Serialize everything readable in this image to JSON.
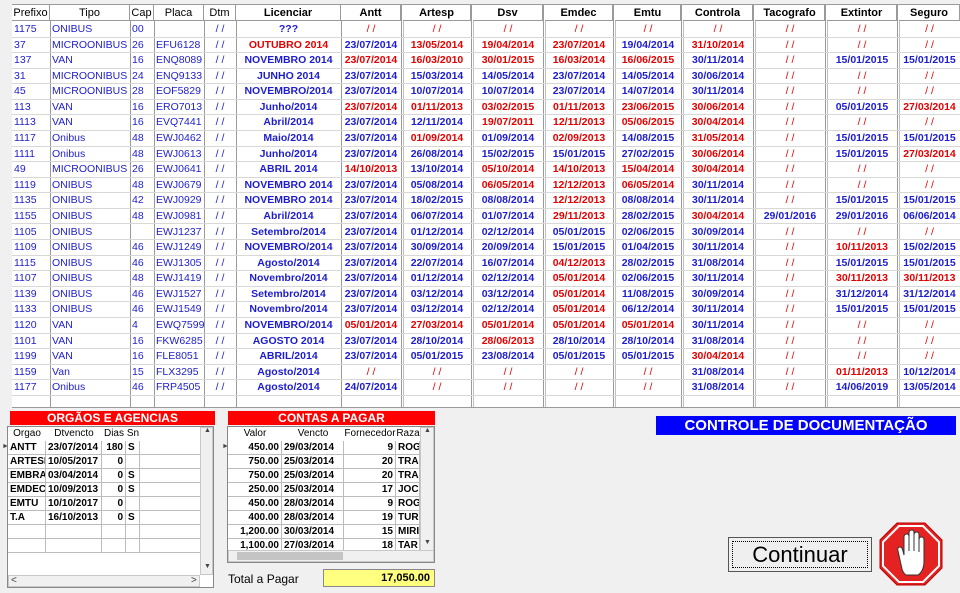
{
  "columns": [
    "Prefixo",
    "Tipo",
    "Cap",
    "Placa",
    "Dtm",
    "Licenciar",
    "Antt",
    "Artesp",
    "Dsv",
    "Emdec",
    "Emtu",
    "Controla",
    "Tacografo",
    "Extintor",
    "Seguro"
  ],
  "rows": [
    [
      "1175",
      "ONIBUS",
      "00",
      "",
      "/ /",
      "???",
      "/ /",
      "/ /",
      "/ /",
      "/ /",
      "/ /",
      "/ /",
      "/ /",
      "/ /",
      "/ /"
    ],
    [
      "37",
      "MICROONIBUS",
      "26",
      "EFU6128",
      "/ /",
      "OUTUBRO 2014",
      "23/07/2014",
      "13/05/2014",
      "19/04/2014",
      "23/07/2014",
      "19/04/2014",
      "31/10/2014",
      "/ /",
      "/ /",
      "/ /"
    ],
    [
      "137",
      "VAN",
      "16",
      "ENQ8089",
      "/ /",
      "NOVEMBRO 2014",
      "23/07/2014",
      "16/03/2010",
      "30/01/2015",
      "16/03/2014",
      "16/06/2015",
      "30/11/2014",
      "/ /",
      "15/01/2015",
      "15/01/2015"
    ],
    [
      "31",
      "MICROONIBUS",
      "24",
      "ENQ9133",
      "/ /",
      "JUNHO 2014",
      "23/07/2014",
      "15/03/2014",
      "14/05/2014",
      "23/07/2014",
      "14/05/2014",
      "30/06/2014",
      "/ /",
      "/ /",
      "/ /"
    ],
    [
      "45",
      "MICROONIBUS",
      "28",
      "EOF5829",
      "/ /",
      "NOVEMBRO/2014",
      "23/07/2014",
      "10/07/2014",
      "10/07/2014",
      "23/07/2014",
      "14/07/2014",
      "30/11/2014",
      "/ /",
      "/ /",
      "/ /"
    ],
    [
      "113",
      "VAN",
      "16",
      "ERO7013",
      "/ /",
      "Junho/2014",
      "23/07/2014",
      "01/11/2013",
      "03/02/2015",
      "01/11/2013",
      "23/06/2015",
      "30/06/2014",
      "/ /",
      "05/01/2015",
      "27/03/2014"
    ],
    [
      "1113",
      "VAN",
      "16",
      "EVQ7441",
      "/ /",
      "Abril/2014",
      "23/07/2014",
      "12/11/2014",
      "19/07/2011",
      "12/11/2013",
      "05/06/2015",
      "30/04/2014",
      "/ /",
      "/ /",
      "/ /"
    ],
    [
      "1117",
      "Onibus",
      "48",
      "EWJ0462",
      "/ /",
      "Maio/2014",
      "23/07/2014",
      "01/09/2014",
      "01/09/2014",
      "02/09/2013",
      "14/08/2015",
      "31/05/2014",
      "/ /",
      "15/01/2015",
      "15/01/2015"
    ],
    [
      "1111",
      "Onibus",
      "48",
      "EWJ0613",
      "/ /",
      "Junho/2014",
      "23/07/2014",
      "26/08/2014",
      "15/02/2015",
      "15/01/2015",
      "27/02/2015",
      "30/06/2014",
      "/ /",
      "15/01/2015",
      "27/03/2014"
    ],
    [
      "49",
      "MICROONIBUS",
      "26",
      "EWJ0641",
      "/ /",
      "ABRIL 2014",
      "14/10/2013",
      "13/10/2014",
      "05/10/2014",
      "14/10/2013",
      "15/04/2014",
      "30/04/2014",
      "/ /",
      "/ /",
      "/ /"
    ],
    [
      "1119",
      "ONIBUS",
      "48",
      "EWJ0679",
      "/ /",
      "NOVEMBRO 2014",
      "23/07/2014",
      "05/08/2014",
      "06/05/2014",
      "12/12/2013",
      "06/05/2014",
      "30/11/2014",
      "/ /",
      "/ /",
      "/ /"
    ],
    [
      "1135",
      "ONIBUS",
      "42",
      "EWJ0929",
      "/ /",
      "NOVEMBRO 2014",
      "23/07/2014",
      "18/02/2015",
      "08/08/2014",
      "12/12/2013",
      "08/08/2014",
      "30/11/2014",
      "/ /",
      "15/01/2015",
      "15/01/2015"
    ],
    [
      "1155",
      "ONIBUS",
      "48",
      "EWJ0981",
      "/ /",
      "Abril/2014",
      "23/07/2014",
      "06/07/2014",
      "01/07/2014",
      "29/11/2013",
      "28/02/2015",
      "30/04/2014",
      "29/01/2016",
      "29/01/2016",
      "06/06/2014"
    ],
    [
      "1105",
      "ONIBUS",
      "",
      "EWJ1237",
      "/ /",
      "Setembro/2014",
      "23/07/2014",
      "01/12/2014",
      "02/12/2014",
      "05/01/2015",
      "02/06/2015",
      "30/09/2014",
      "/ /",
      "/ /",
      "/ /"
    ],
    [
      "1109",
      "ONIBUS",
      "46",
      "EWJ1249",
      "/ /",
      "NOVEMBRO/2014",
      "23/07/2014",
      "30/09/2014",
      "20/09/2014",
      "15/01/2015",
      "01/04/2015",
      "30/11/2014",
      "/ /",
      "10/11/2013",
      "15/02/2015"
    ],
    [
      "1115",
      "ONIBUS",
      "46",
      "EWJ1305",
      "/ /",
      "Agosto/2014",
      "23/07/2014",
      "22/07/2014",
      "16/07/2014",
      "04/12/2013",
      "28/02/2015",
      "31/08/2014",
      "/ /",
      "15/01/2015",
      "15/01/2015"
    ],
    [
      "1107",
      "ONIBUS",
      "48",
      "EWJ1419",
      "/ /",
      "Novembro/2014",
      "23/07/2014",
      "01/12/2014",
      "02/12/2014",
      "05/01/2014",
      "02/06/2015",
      "30/11/2014",
      "/ /",
      "30/11/2013",
      "30/11/2013"
    ],
    [
      "1139",
      "ONIBUS",
      "46",
      "EWJ1527",
      "/ /",
      "Setembro/2014",
      "23/07/2014",
      "03/12/2014",
      "03/12/2014",
      "05/01/2014",
      "11/08/2015",
      "30/09/2014",
      "/ /",
      "31/12/2014",
      "31/12/2014"
    ],
    [
      "1133",
      "ONIBUS",
      "46",
      "EWJ1549",
      "/ /",
      "Novembro/2014",
      "23/07/2014",
      "03/12/2014",
      "02/12/2014",
      "05/01/2014",
      "06/12/2014",
      "30/11/2014",
      "/ /",
      "15/01/2015",
      "15/01/2015"
    ],
    [
      "1120",
      "VAN",
      "4",
      "EWQ7599",
      "/ /",
      "NOVEMBRO/2014",
      "05/01/2014",
      "27/03/2014",
      "05/01/2014",
      "05/01/2014",
      "05/01/2014",
      "30/11/2014",
      "/ /",
      "/ /",
      "/ /"
    ],
    [
      "1101",
      "VAN",
      "16",
      "FKW6285",
      "/ /",
      "AGOSTO 2014",
      "23/07/2014",
      "28/10/2014",
      "28/06/2013",
      "28/10/2014",
      "28/10/2014",
      "31/08/2014",
      "/ /",
      "/ /",
      "/ /"
    ],
    [
      "1199",
      "VAN",
      "16",
      "FLE8051",
      "/ /",
      "ABRIL/2014",
      "23/07/2014",
      "05/01/2015",
      "23/08/2014",
      "05/01/2015",
      "05/01/2015",
      "30/04/2014",
      "/ /",
      "/ /",
      "/ /"
    ],
    [
      "1159",
      "Van",
      "15",
      "FLX3295",
      "/ /",
      "Agosto/2014",
      "/ /",
      "/ /",
      "/ /",
      "/ /",
      "/ /",
      "31/08/2014",
      "/ /",
      "01/11/2013",
      "10/12/2014"
    ],
    [
      "1177",
      "Onibus",
      "46",
      "FRP4505",
      "/ /",
      "Agosto/2014",
      "24/07/2014",
      "/ /",
      "/ /",
      "/ /",
      "/ /",
      "31/08/2014",
      "/ /",
      "14/06/2019",
      "13/05/2014"
    ]
  ],
  "red_cells": [
    [
      5,
      1
    ],
    [
      7,
      1
    ],
    [
      8,
      1
    ],
    [
      9,
      1
    ],
    [
      11,
      1
    ],
    [
      6,
      2
    ],
    [
      7,
      2
    ],
    [
      8,
      2
    ],
    [
      9,
      2
    ],
    [
      10,
      2
    ],
    [
      9,
      5
    ],
    [
      6,
      5
    ],
    [
      7,
      5
    ],
    [
      8,
      5
    ],
    [
      9,
      5
    ],
    [
      10,
      5
    ],
    [
      11,
      5
    ],
    [
      8,
      6
    ],
    [
      9,
      6
    ],
    [
      10,
      6
    ],
    [
      11,
      6
    ],
    [
      7,
      7
    ],
    [
      9,
      7
    ],
    [
      11,
      7
    ],
    [
      14,
      8
    ],
    [
      11,
      8
    ],
    [
      6,
      9
    ],
    [
      8,
      9
    ],
    [
      9,
      9
    ],
    [
      10,
      9
    ],
    [
      11,
      9
    ],
    [
      8,
      10
    ],
    [
      9,
      10
    ],
    [
      10,
      10
    ],
    [
      9,
      11
    ],
    [
      9,
      12
    ],
    [
      11,
      12
    ],
    [
      13,
      14
    ],
    [
      9,
      15
    ],
    [
      9,
      16
    ],
    [
      13,
      16
    ],
    [
      14,
      16
    ],
    [
      9,
      17
    ],
    [
      9,
      18
    ],
    [
      6,
      19
    ],
    [
      7,
      19
    ],
    [
      8,
      19
    ],
    [
      9,
      19
    ],
    [
      10,
      19
    ],
    [
      8,
      20
    ],
    [
      11,
      21
    ],
    [
      13,
      22
    ],
    [
      14,
      5
    ]
  ],
  "orgaos": {
    "title": "ORGÃOS E AGENCIAS",
    "headers": [
      "Orgao",
      "Dtvencto",
      "Dias",
      "Sn"
    ],
    "rows": [
      [
        "ANTT",
        "23/07/2014",
        "180",
        "S"
      ],
      [
        "ARTESP",
        "10/05/2017",
        "0",
        ""
      ],
      [
        "EMBRATUR",
        "03/04/2014",
        "0",
        "S"
      ],
      [
        "EMDEC",
        "10/09/2013",
        "0",
        "S"
      ],
      [
        "EMTU",
        "10/10/2017",
        "0",
        ""
      ],
      [
        "T.A",
        "16/10/2013",
        "0",
        "S"
      ]
    ]
  },
  "contas": {
    "title": "CONTAS A PAGAR",
    "headers": [
      "Valor",
      "Vencto",
      "Fornecedor",
      "Raza"
    ],
    "rows": [
      [
        "450.00",
        "29/03/2014",
        "9",
        "ROG"
      ],
      [
        "750.00",
        "25/03/2014",
        "20",
        "TRA"
      ],
      [
        "750.00",
        "25/03/2014",
        "20",
        "TRA"
      ],
      [
        "250.00",
        "25/03/2014",
        "17",
        "JOC"
      ],
      [
        "450.00",
        "28/03/2014",
        "9",
        "ROG"
      ],
      [
        "400.00",
        "28/03/2014",
        "19",
        "TURI"
      ],
      [
        "1,200.00",
        "30/03/2014",
        "15",
        "MIRI"
      ],
      [
        "1,100.00",
        "27/03/2014",
        "18",
        "TAR"
      ]
    ]
  },
  "total_label": "Total a Pagar",
  "total_value": "17,050.00",
  "title_banner": "CONTROLE DE  DOCUMENTAÇÃO",
  "continue_label": "Continuar",
  "colors": {
    "blue": "#1d1dcf",
    "red": "#e50000",
    "banner": "#0000ff",
    "header_red": "#ff0000",
    "total_bg": "#ffff80"
  }
}
